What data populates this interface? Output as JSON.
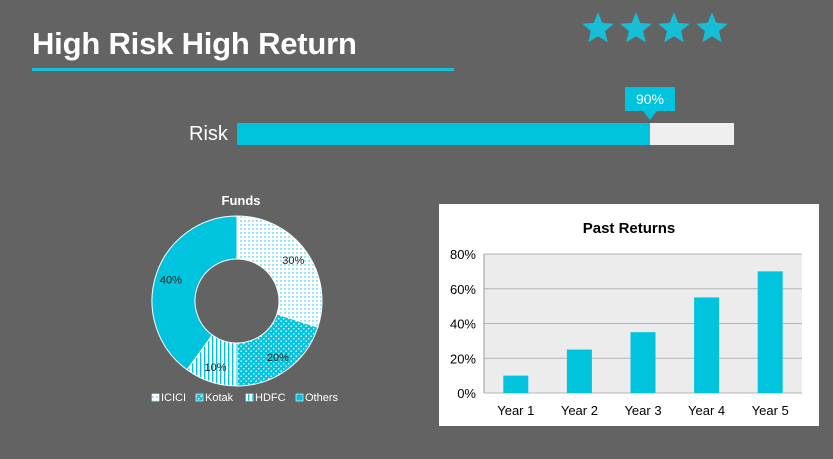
{
  "header": {
    "title": "High Risk High Return",
    "rating_stars": 4,
    "star_color": "#16bfd6"
  },
  "risk": {
    "label": "Risk",
    "value_label": "90%",
    "value_fraction": 0.83,
    "fill_color": "#00c4de",
    "track_color": "#efefef"
  },
  "chart_data": [
    {
      "type": "pie",
      "variant": "donut",
      "title": "Funds",
      "categories": [
        "ICICI",
        "Kotak",
        "HDFC",
        "Others"
      ],
      "values": [
        30,
        20,
        10,
        40
      ],
      "labels": [
        "30%",
        "20%",
        "10%",
        "40%"
      ],
      "colors": [
        "#00c4de",
        "#00c4de",
        "#00c4de",
        "#00c4de"
      ],
      "fills": [
        "dots",
        "diagonal-dots",
        "vertical-lines",
        "solid"
      ],
      "legend": "bottom"
    },
    {
      "type": "bar",
      "title": "Past Returns",
      "categories": [
        "Year 1",
        "Year 2",
        "Year 3",
        "Year 4",
        "Year 5"
      ],
      "values": [
        10,
        25,
        35,
        55,
        70
      ],
      "ylim": [
        0,
        80
      ],
      "yticks": [
        "0%",
        "20%",
        "40%",
        "60%",
        "80%"
      ],
      "grid": true,
      "bar_color": "#00c4de"
    }
  ]
}
